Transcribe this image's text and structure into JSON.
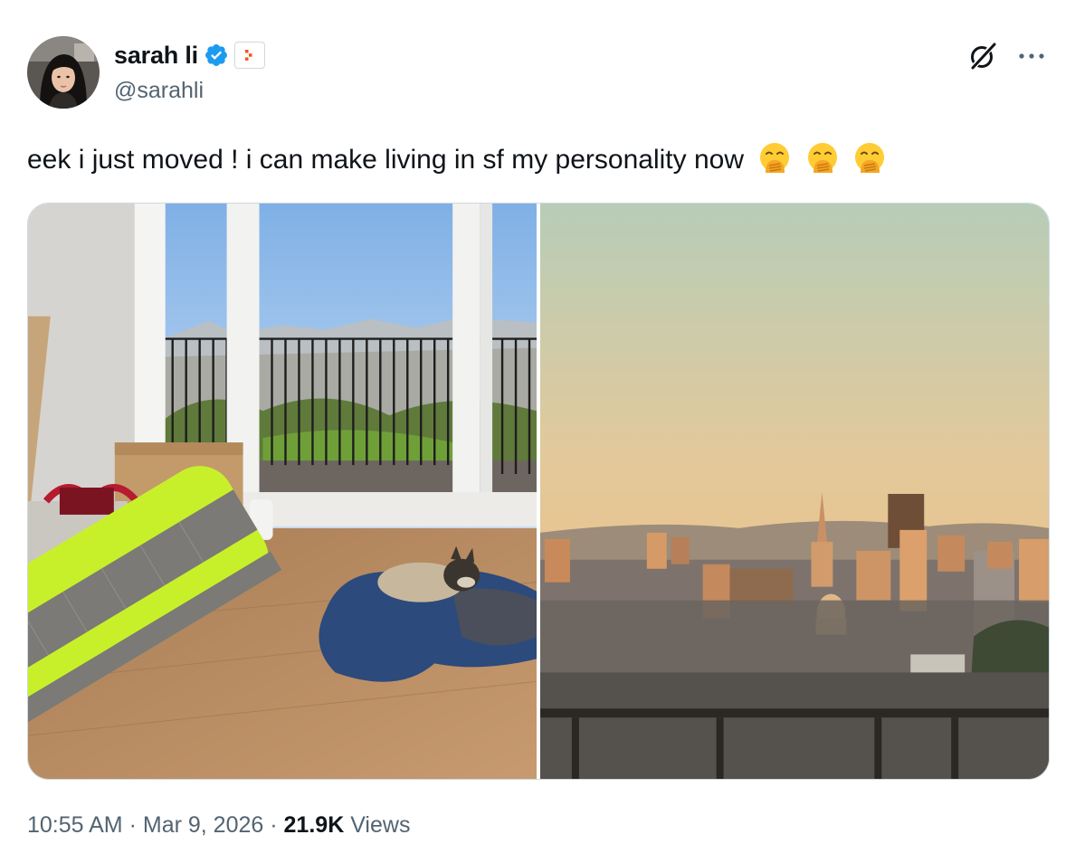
{
  "author": {
    "display_name": "sarah li",
    "handle": "@sarahli",
    "verified": true,
    "avatar_icon": "profile-photo"
  },
  "tweet": {
    "text": "eek i just moved ! i can make living in sf my personality now",
    "emoji": [
      "🤭",
      "🤭",
      "🤭"
    ]
  },
  "media": [
    {
      "icon": "photo-apartment-room-with-dog-and-sleeping-pad"
    },
    {
      "icon": "photo-san-francisco-skyline-at-sunset"
    }
  ],
  "meta": {
    "time": "10:55 AM",
    "separator": "·",
    "date": "Mar 9, 2026",
    "views_count": "21.9K",
    "views_label": "Views"
  },
  "colors": {
    "verified_blue": "#1d9bf0",
    "text_primary": "#0f1419",
    "text_secondary": "#536471",
    "border": "#cfd9de",
    "pad_lime": "#c8f02a"
  }
}
